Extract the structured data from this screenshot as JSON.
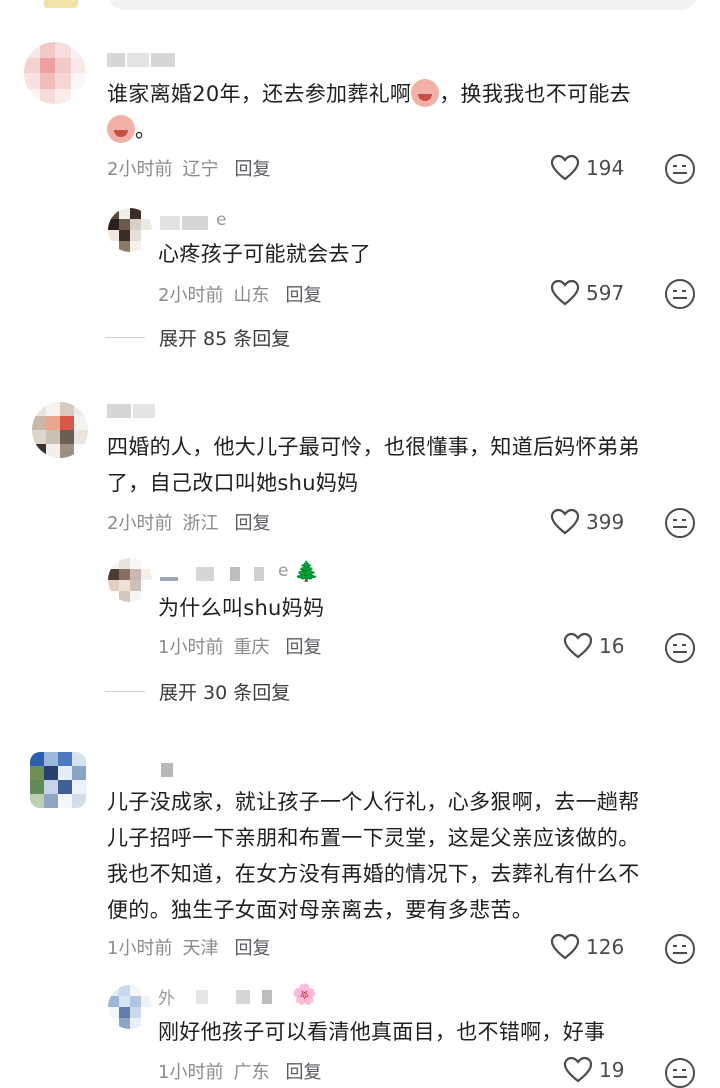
{
  "comments": [
    {
      "text_lines": [
        "谁家离婚20年，还去参加葬礼啊",
        "，换我我也不可能去",
        "。"
      ],
      "time": "2小时前",
      "location": "辽宁",
      "reply_label": "回复",
      "likes": "194",
      "reply": {
        "name_suffix": "e",
        "text": "心疼孩子可能就会去了",
        "time": "2小时前",
        "location": "山东",
        "reply_label": "回复",
        "likes": "597"
      },
      "expand_label": "展开 85 条回复"
    },
    {
      "text_lines": [
        "四婚的人，他大儿子最可怜，也很懂事，知道后妈怀弟弟",
        "了，自己改口叫她shu妈妈"
      ],
      "time": "2小时前",
      "location": "浙江",
      "reply_label": "回复",
      "likes": "399",
      "reply": {
        "name_suffix": "e",
        "name_emoji": "🌲",
        "text": "为什么叫shu妈妈",
        "time": "1小时前",
        "location": "重庆",
        "reply_label": "回复",
        "likes": "16"
      },
      "expand_label": "展开 30 条回复"
    },
    {
      "text_lines": [
        "儿子没成家，就让孩子一个人行礼，心多狠啊，去一趟帮",
        "儿子招呼一下亲朋和布置一下灵堂，这是父亲应该做的。",
        "我也不知道，在女方没有再婚的情况下，去葬礼有什么不",
        "便的。独生子女面对母亲离去，要有多悲苦。"
      ],
      "time": "1小时前",
      "location": "天津",
      "reply_label": "回复",
      "likes": "126",
      "reply": {
        "name_prefix": "外",
        "name_emoji": "🌸",
        "text": "刚好他孩子可以看清他真面目，也不错啊，好事",
        "time": "1小时前",
        "location": "广东",
        "reply_label": "回复",
        "likes": "19"
      }
    }
  ],
  "icons": {
    "like": "heart-outline-icon",
    "dislike": "meh-face-icon",
    "emoji": "crying-face-emoji"
  },
  "colors": {
    "text": "#1f1f1f",
    "meta": "#8b8b90",
    "background": "#ffffff"
  }
}
